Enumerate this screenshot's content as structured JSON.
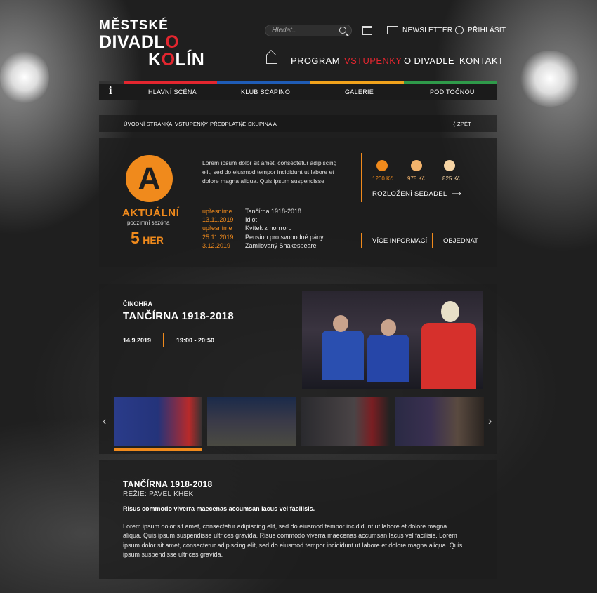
{
  "logo": {
    "line1": "MĚSTSKÉ",
    "line2a": "DIVADL",
    "line2b": "O",
    "line3a": "K",
    "line3b": "O",
    "line3c": "LÍN"
  },
  "header": {
    "search_placeholder": "Hledat..",
    "newsletter": "NEWSLETTER",
    "login": "PŘIHLÁSIT"
  },
  "nav": {
    "program": "PROGRAM",
    "tickets": "VSTUPENKY",
    "about": "O DIVADLE",
    "contact": "KONTAKT"
  },
  "subnav": {
    "info": "i",
    "main": "HLAVNÍ SCÉNA",
    "club": "KLUB SCAPINO",
    "gallery": "GALERIE",
    "stage": "POD TOČNOU"
  },
  "breadcrumb": {
    "home": "ÚVODNÍ STRÁNKA",
    "tickets": "VSTUPENKY",
    "subscription": "PŘEDPLATNÉ",
    "group": "SKUPINA A",
    "back": "ZPĚT"
  },
  "group": {
    "letter": "A",
    "status": "AKTUÁLNÍ",
    "season": "podzimní sezóna",
    "count": "5",
    "count_label": "HER",
    "text": "Lorem ipsum dolor sit amet, consectetur adipiscing elit, sed do eiusmod tempor incididunt ut labore et dolore magna aliqua. Quis ipsum suspendisse",
    "shows": [
      {
        "date": "upřesníme",
        "title": "Tančírna 1918-2018"
      },
      {
        "date": "13.11.2019",
        "title": "Idiot"
      },
      {
        "date": "upřesníme",
        "title": "Kvítek z horrroru"
      },
      {
        "date": "25.11.2019",
        "title": "Pension pro svobodné pány"
      },
      {
        "date": "3.12.2019",
        "title": "Zamilovaný Shakespeare"
      }
    ],
    "prices": [
      "1200 Kč",
      "975 Kč",
      "825 Kč"
    ],
    "seating": "ROZLOŽENÍ SEDADEL",
    "more": "VÍCE INFORMACÍ",
    "order": "OBJEDNAT"
  },
  "colors": {
    "accent": "#f08a1c",
    "red": "#e3262f",
    "blue": "#1f5cb6",
    "yellow": "#f0a21c",
    "green": "#2f9a4a"
  },
  "feature": {
    "genre": "ČINOHRA",
    "title": "TANČÍRNA 1918-2018",
    "date": "14.9.2019",
    "time": "19:00 - 20:50"
  },
  "detail": {
    "title": "TANČÍRNA 1918-2018",
    "director": "REŽIE: PAVEL KHEK",
    "lead": "Risus commodo viverra maecenas accumsan lacus vel facilisis.",
    "body": "Lorem ipsum dolor sit amet, consectetur adipiscing elit, sed do eiusmod tempor incididunt ut labore et dolore magna aliqua. Quis ipsum suspendisse ultrices gravida. Risus commodo viverra maecenas accumsan lacus vel facilisis.  Lorem ipsum dolor sit amet, consectetur adipiscing elit, sed do eiusmod tempor incididunt ut labore et dolore magna aliqua. Quis ipsum suspendisse ultrices gravida."
  }
}
